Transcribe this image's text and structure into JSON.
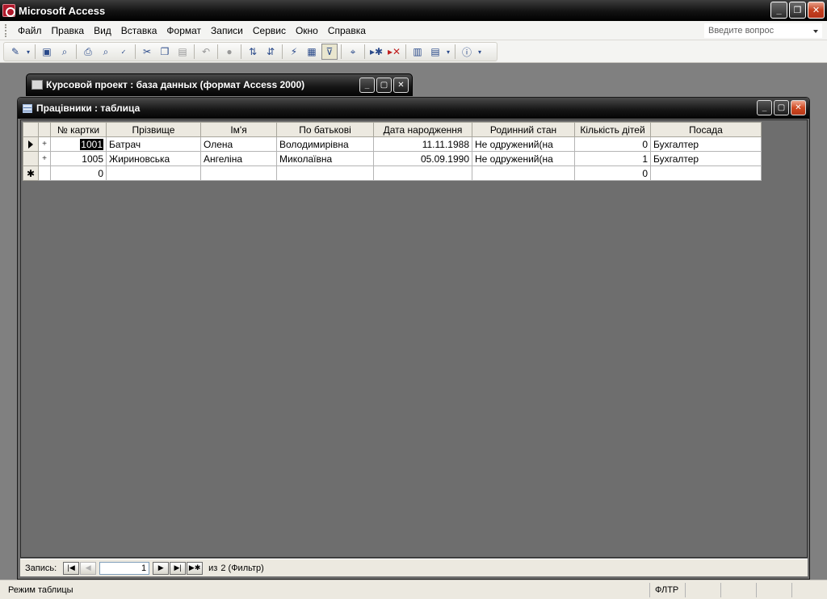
{
  "app": {
    "title": "Microsoft Access",
    "controls": {
      "minimize": "_",
      "maximize": "❐",
      "close": "✕"
    }
  },
  "menu": {
    "items": [
      "Файл",
      "Правка",
      "Вид",
      "Вставка",
      "Формат",
      "Записи",
      "Сервис",
      "Окно",
      "Справка"
    ],
    "help_placeholder": "Введите вопрос"
  },
  "toolbar": {
    "icons": [
      "view-icon",
      "save-icon",
      "file-search-icon",
      "print-icon",
      "print-preview-icon",
      "spelling-icon",
      "cut-icon",
      "copy-icon",
      "paste-icon",
      "undo-icon",
      "hyperlink-icon",
      "sort-ascending-icon",
      "sort-descending-icon",
      "filter-by-selection-icon",
      "filter-by-form-icon",
      "apply-filter-icon",
      "find-icon",
      "new-record-icon",
      "delete-record-icon",
      "database-window-icon",
      "new-object-icon",
      "help-icon"
    ]
  },
  "db_window": {
    "title": "Курсовой проект : база данных (формат Access 2000)"
  },
  "table_window": {
    "title": "Працівники : таблица",
    "columns": [
      "№ картки",
      "Прізвище",
      "Ім'я",
      "По батькові",
      "Дата народження",
      "Родинний стан",
      "Кількість дітей",
      "Посада"
    ],
    "rows": [
      {
        "card_no": "1001",
        "surname": "Батрач",
        "name": "Олена",
        "patronymic": "Володимирівна",
        "birth_date": "11.11.1988",
        "marital": "Не одружений(на",
        "children": "0",
        "position": "Бухгалтер"
      },
      {
        "card_no": "1005",
        "surname": "Жириновська",
        "name": "Ангеліна",
        "patronymic": "Миколаївна",
        "birth_date": "05.09.1990",
        "marital": "Не одружений(на",
        "children": "1",
        "position": "Бухгалтер"
      }
    ],
    "new_row": {
      "card_no": "0",
      "children": "0"
    },
    "expand_symbol": "+",
    "new_row_symbol": "✱"
  },
  "navigation": {
    "label": "Запись:",
    "current": "1",
    "of_text": "из",
    "total_text": "2 (Фильтр)"
  },
  "status": {
    "mode": "Режим таблицы",
    "filter": "ФЛТР"
  }
}
